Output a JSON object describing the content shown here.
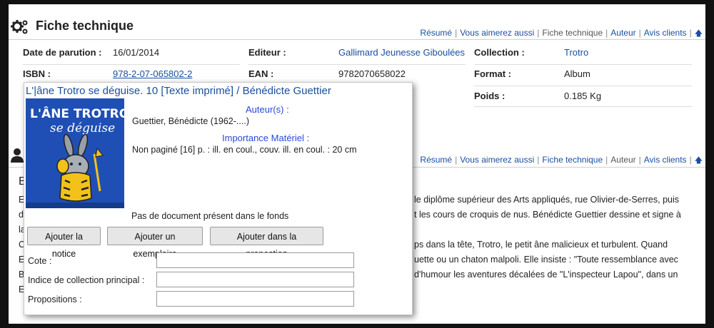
{
  "section1": {
    "title": "Fiche technique",
    "nav": [
      "Résumé",
      "Vous aimerez aussi",
      "Fiche technique",
      "Auteur",
      "Avis clients"
    ]
  },
  "details": {
    "date_label": "Date de parution :",
    "date_value": "16/01/2014",
    "editeur_label": "Editeur :",
    "editeur_value": "Gallimard Jeunesse Giboulées",
    "collection_label": "Collection :",
    "collection_value": "Trotro",
    "isbn_label": "ISBN :",
    "isbn_value": "978-2-07-065802-2",
    "ean_label": "EAN :",
    "ean_value": "9782070658022",
    "format_label": "Format :",
    "format_value": "Album",
    "poids_label": "Poids :",
    "poids_value": "0.185 Kg"
  },
  "section2": {
    "nav": [
      "Résumé",
      "Vous aimerez aussi",
      "Fiche technique",
      "Auteur",
      "Avis clients"
    ],
    "heading_letter": "B",
    "bio_line1": "le diplôme supérieur des Arts appliqués, rue Olivier-de-Serres, puis",
    "bio_line2": "t les cours de croquis de nus. Bénédicte Guettier dessine et signe à",
    "bio_line3": "ps dans la tête, Trotro, le petit âne malicieux et turbulent. Quand",
    "bio_line4": "uette ou un chaton malpoli. Elle insiste : \"Toute ressemblance avec",
    "bio_line5": "d'humour les aventures décalées de \"L'inspecteur Lapou\", dans un",
    "left_letters": [
      "E",
      "d",
      "la",
      "C",
      "E",
      "B",
      "E"
    ]
  },
  "popup": {
    "title": "L'|âne Trotro se déguise. 10 [Texte imprimé] / Bénédicte Guettier",
    "cover_title_line1": "L'ÂNE TROTRO",
    "cover_title_line2": "se déguise",
    "auteur_heading": "Auteur(s) :",
    "auteur_value": "Guettier, Bénédicte (1962-....)",
    "materiel_heading": "Importance Matériel :",
    "materiel_value": "Non paginé [16] p. : ill. en coul., couv. ill. en coul. : 20 cm",
    "status": "Pas de document présent dans le fonds",
    "btn_notice": "Ajouter la notice",
    "btn_exemplaire": "Ajouter un exemplaire",
    "btn_proposition": "Ajouter dans la propostion",
    "field_cote": "Cote :",
    "field_indice": "Indice de collection principal :",
    "field_propositions": "Propositions :",
    "colors": {
      "link": "#1a4fa0",
      "heading": "#2a48d8",
      "cover_bg": "#1a4fa0"
    }
  }
}
